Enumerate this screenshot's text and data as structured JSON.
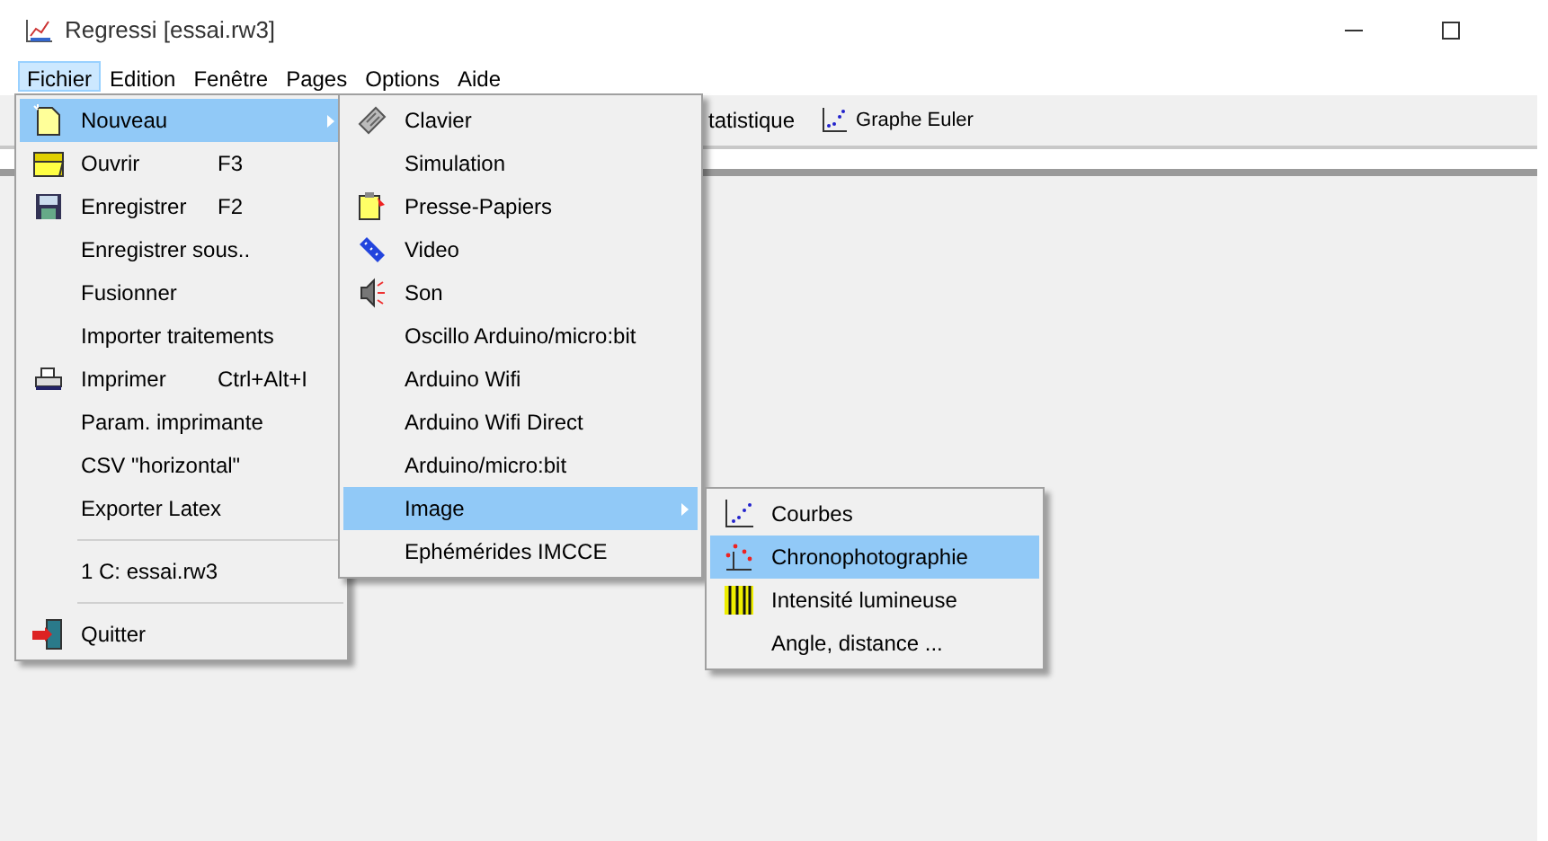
{
  "window": {
    "title": "Regressi [essai.rw3]"
  },
  "menubar": [
    {
      "label": "Fichier",
      "selected": true
    },
    {
      "label": "Edition",
      "selected": false
    },
    {
      "label": "Fenêtre",
      "selected": false
    },
    {
      "label": "Pages",
      "selected": false
    },
    {
      "label": "Options",
      "selected": false
    },
    {
      "label": "Aide",
      "selected": false
    }
  ],
  "toolbar": [
    {
      "label": "tatistique"
    },
    {
      "label": "Graphe Euler"
    }
  ],
  "file_menu": [
    {
      "kind": "item",
      "label": "Nouveau",
      "submenu": true,
      "selected": true
    },
    {
      "kind": "item",
      "label": "Ouvrir",
      "shortcut": "F3",
      "submenu": false,
      "selected": false
    },
    {
      "kind": "item",
      "label": "Enregistrer",
      "shortcut": "F2",
      "submenu": false,
      "selected": false
    },
    {
      "kind": "item",
      "label": "Enregistrer sous..",
      "submenu": false,
      "selected": false
    },
    {
      "kind": "item",
      "label": "Fusionner",
      "submenu": false,
      "selected": false
    },
    {
      "kind": "item",
      "label": "Importer traitements",
      "submenu": false,
      "selected": false
    },
    {
      "kind": "item",
      "label": "Imprimer",
      "shortcut": "Ctrl+Alt+I",
      "submenu": false,
      "selected": false
    },
    {
      "kind": "item",
      "label": "Param. imprimante",
      "submenu": false,
      "selected": false
    },
    {
      "kind": "item",
      "label": "CSV \"horizontal\"",
      "submenu": false,
      "selected": false
    },
    {
      "kind": "item",
      "label": "Exporter Latex",
      "submenu": false,
      "selected": false
    },
    {
      "kind": "separator"
    },
    {
      "kind": "item",
      "label": "1 C: essai.rw3",
      "submenu": false,
      "selected": false
    },
    {
      "kind": "separator"
    },
    {
      "kind": "item",
      "label": "Quitter",
      "submenu": false,
      "selected": false
    }
  ],
  "new_menu": [
    {
      "label": "Clavier",
      "submenu": false,
      "selected": false
    },
    {
      "label": "Simulation",
      "submenu": false,
      "selected": false
    },
    {
      "label": "Presse-Papiers",
      "submenu": false,
      "selected": false
    },
    {
      "label": "Video",
      "submenu": false,
      "selected": false
    },
    {
      "label": "Son",
      "submenu": false,
      "selected": false
    },
    {
      "label": "Oscillo Arduino/micro:bit",
      "submenu": false,
      "selected": false
    },
    {
      "label": "Arduino Wifi",
      "submenu": false,
      "selected": false
    },
    {
      "label": "Arduino Wifi Direct",
      "submenu": false,
      "selected": false
    },
    {
      "label": "Arduino/micro:bit",
      "submenu": false,
      "selected": false
    },
    {
      "label": "Image",
      "submenu": true,
      "selected": true
    },
    {
      "label": "Ephémérides IMCCE",
      "submenu": false,
      "selected": false
    }
  ],
  "image_menu": [
    {
      "label": "Courbes",
      "selected": false
    },
    {
      "label": "Chronophotographie",
      "selected": true
    },
    {
      "label": "Intensité lumineuse",
      "selected": false
    },
    {
      "label": "Angle, distance ...",
      "selected": false
    }
  ]
}
